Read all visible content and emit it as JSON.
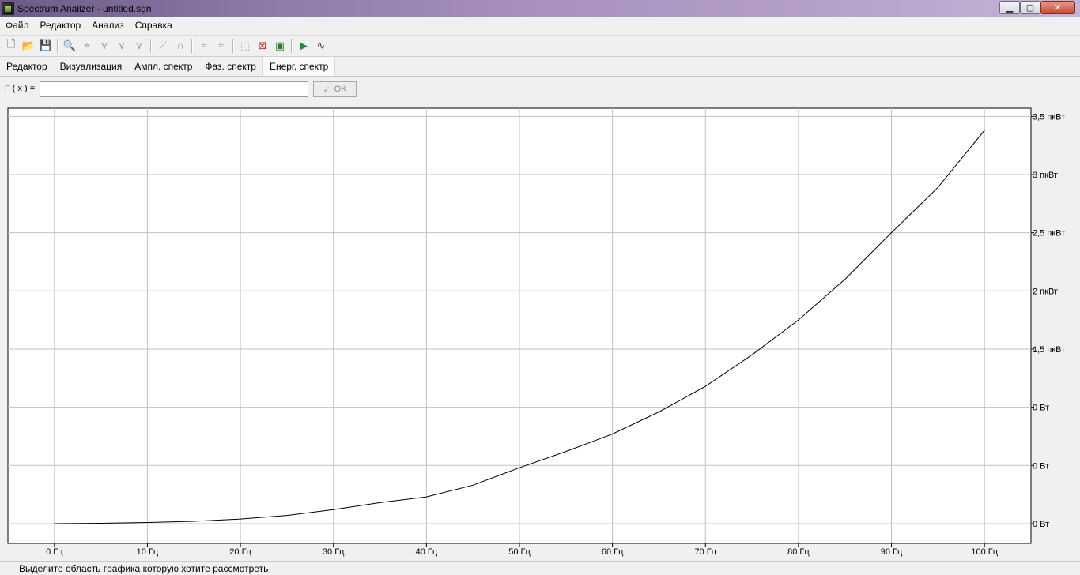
{
  "window": {
    "title": "Spectrum Analizer - untitled.sgn",
    "buttons": {
      "minimize": "▁",
      "maximize": "▢",
      "close": "✕"
    }
  },
  "menu": {
    "items": [
      {
        "label": "Файл"
      },
      {
        "label": "Редактор"
      },
      {
        "label": "Анализ"
      },
      {
        "label": "Справка"
      }
    ]
  },
  "toolbar": {
    "buttons": [
      {
        "name": "new-file-icon",
        "glyph": "🗋"
      },
      {
        "name": "open-folder-icon",
        "glyph": "📂"
      },
      {
        "name": "save-icon",
        "glyph": "💾"
      },
      {
        "name": "zoom-icon",
        "glyph": "🔍"
      },
      {
        "name": "crosshair-icon",
        "glyph": "⌖"
      },
      {
        "name": "filter-low-icon",
        "glyph": "⋎"
      },
      {
        "name": "filter-high-icon",
        "glyph": "⋎"
      },
      {
        "name": "filter-band-icon",
        "glyph": "⋎"
      },
      {
        "name": "line-icon",
        "glyph": "⟋"
      },
      {
        "name": "curve-icon",
        "glyph": "∩"
      },
      {
        "name": "wave-shift-left-icon",
        "glyph": "≈"
      },
      {
        "name": "wave-shift-right-icon",
        "glyph": "≈"
      },
      {
        "name": "zoom-region-icon",
        "glyph": "⬚"
      },
      {
        "name": "zoom-reset-icon",
        "glyph": "⊠"
      },
      {
        "name": "graph-window-icon",
        "glyph": "▣"
      },
      {
        "name": "play-icon",
        "glyph": "▶"
      },
      {
        "name": "waveform-icon",
        "glyph": "∿"
      }
    ]
  },
  "tabs": [
    {
      "label": "Редактор"
    },
    {
      "label": "Визуализация"
    },
    {
      "label": "Ампл. спектр"
    },
    {
      "label": "Фаз. спектр"
    },
    {
      "label": "Енерг. спектр",
      "active": true
    }
  ],
  "function_input": {
    "label": "F ( x ) =",
    "value": "",
    "ok_label": "OK"
  },
  "status": {
    "text": "Выделите область графика которую хотите рассмотреть"
  },
  "colors": {
    "line": "#000000",
    "grid": "#c0c0c0",
    "plot_background": "#ffffff"
  },
  "chart_data": {
    "type": "line",
    "x_unit": "Гц",
    "x_ticks": [
      "0 Гц",
      "10 Гц",
      "20 Гц",
      "30 Гц",
      "40 Гц",
      "50 Гц",
      "60 Гц",
      "70 Гц",
      "80 Гц",
      "90 Гц",
      "100 Гц"
    ],
    "x_tick_values": [
      0,
      10,
      20,
      30,
      40,
      50,
      60,
      70,
      80,
      90,
      100
    ],
    "y_ticks": [
      "0 Вт",
      "0 Вт",
      "0 Вт",
      "1,5 пкВт",
      "2 пкВт",
      "2,5 пкВт",
      "3 пкВт",
      "3,5 пкВт"
    ],
    "y_tick_values": [
      0,
      0.5,
      1,
      1.5,
      2,
      2.5,
      3,
      3.5
    ],
    "y_unit": "пкВт",
    "xlim": [
      -5,
      105
    ],
    "ylim": [
      -0.17,
      3.57
    ],
    "grid": true,
    "axis_side": "right",
    "series": [
      {
        "x": [
          0,
          5,
          10,
          15,
          20,
          25,
          30,
          35,
          40,
          45,
          50,
          55,
          60,
          65,
          70,
          75,
          80,
          85,
          90,
          95,
          100
        ],
        "y": [
          0,
          0.003,
          0.01,
          0.02,
          0.04,
          0.07,
          0.12,
          0.18,
          0.23,
          0.33,
          0.48,
          0.62,
          0.77,
          0.96,
          1.18,
          1.45,
          1.75,
          2.1,
          2.5,
          2.89,
          3.38
        ]
      }
    ]
  }
}
